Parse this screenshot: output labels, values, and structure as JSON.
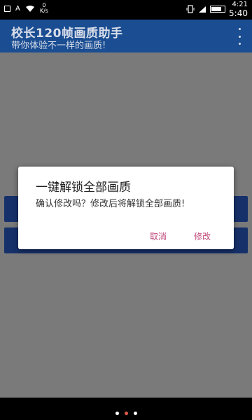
{
  "status_bar": {
    "notification_badge": "A",
    "net_speed_value": "0",
    "net_speed_unit": "K/s",
    "time_small": "4:21",
    "time_main": "5:40"
  },
  "app_bar": {
    "title": "校长120帧画质助手",
    "subtitle": "带你体验不一样的画质!"
  },
  "dialog": {
    "title": "一键解锁全部画质",
    "message": "确认修改吗？修改后将解锁全部画质!",
    "cancel_label": "取消",
    "confirm_label": "修改"
  },
  "pager": {
    "dots": 3,
    "active_index": 1
  },
  "colors": {
    "app_bar": "#1a4d92",
    "accent": "#c04a7a",
    "active_dot": "#e05a4a"
  }
}
